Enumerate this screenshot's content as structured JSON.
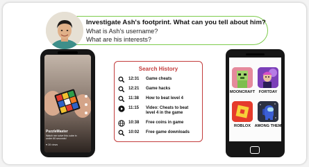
{
  "question": {
    "title": "Investigate Ash's footprint. What can you tell about him?",
    "line1": "What is Ash's username?",
    "line2": "What are his interests?"
  },
  "video": {
    "handle": "PuzzleMaster",
    "caption": "Watch me solve this cube in under 60 seconds!",
    "stat": "♥ 28 views"
  },
  "search_history": {
    "title": "Search History",
    "rows": [
      {
        "icon": "search-icon",
        "time": "12:31",
        "text": "Game cheats"
      },
      {
        "icon": "search-icon",
        "time": "12:21",
        "text": "Game hacks"
      },
      {
        "icon": "search-icon",
        "time": "11:38",
        "text": "How to beat level 4"
      },
      {
        "icon": "play-icon",
        "time": "11:15",
        "text": "Video: Cheats to beat level 4 in the game"
      },
      {
        "icon": "globe-icon",
        "time": "10:38",
        "text": "Free coins in game"
      },
      {
        "icon": "search-icon",
        "time": "10:02",
        "text": "Free game downloads"
      }
    ]
  },
  "apps": [
    {
      "label": "MOONCRAFT",
      "color": "#e58a9c"
    },
    {
      "label": "FORTDAY",
      "color": "#7b3fb8"
    },
    {
      "label": "ROBLOX",
      "color": "#e53b2c"
    },
    {
      "label": "AMONG THEM",
      "color": "#3b55c9"
    }
  ],
  "colors": {
    "bubble_border": "#7ccb4a",
    "history_accent": "#c23b3b",
    "phone": "#161616"
  }
}
